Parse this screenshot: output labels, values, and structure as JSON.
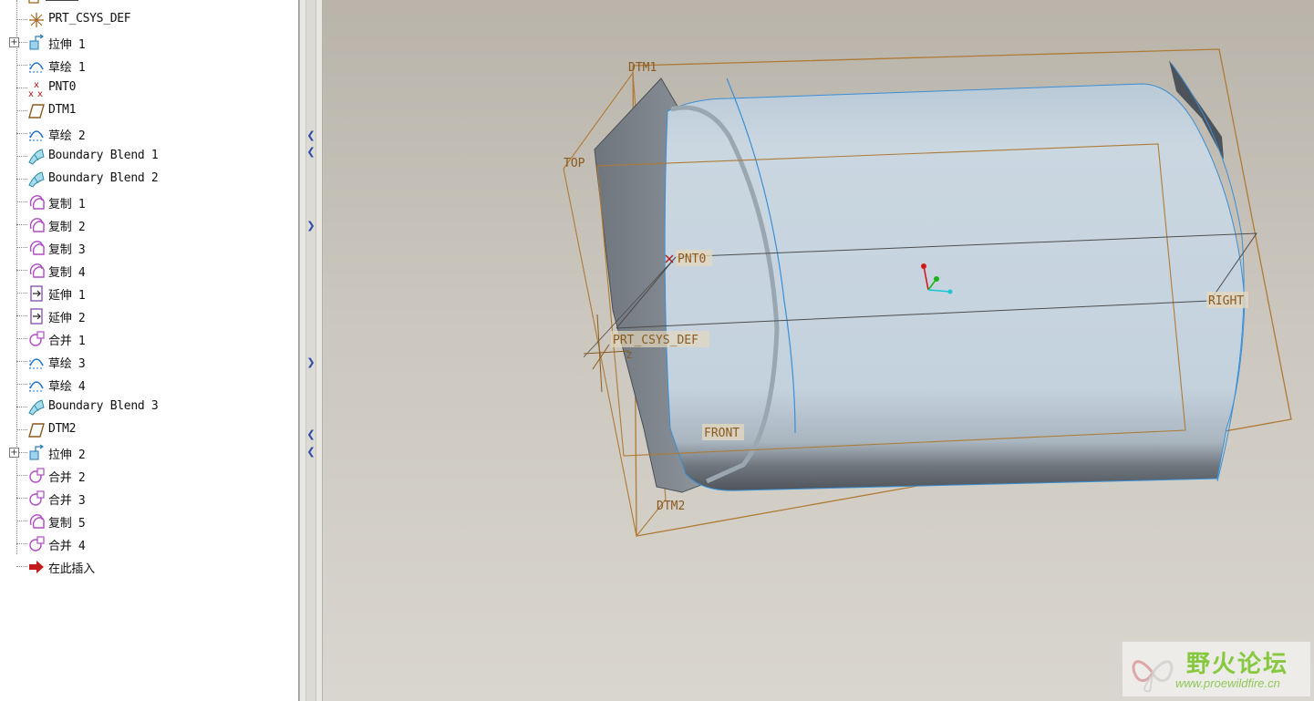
{
  "model_tree": {
    "items": [
      {
        "label": "PRT_CSYS_DEF",
        "icon": "csys-icon",
        "expandable": false
      },
      {
        "label": "拉伸 1",
        "icon": "extrude-icon",
        "expandable": true
      },
      {
        "label": "草绘 1",
        "icon": "sketch-icon",
        "expandable": false
      },
      {
        "label": "PNT0",
        "icon": "datum-point-icon",
        "expandable": false
      },
      {
        "label": "DTM1",
        "icon": "datum-plane-icon",
        "expandable": false
      },
      {
        "label": "草绘 2",
        "icon": "sketch-icon",
        "expandable": false
      },
      {
        "label": "Boundary Blend 1",
        "icon": "boundary-blend-icon",
        "expandable": false
      },
      {
        "label": "Boundary Blend 2",
        "icon": "boundary-blend-icon",
        "expandable": false
      },
      {
        "label": "复制 1",
        "icon": "copy-icon",
        "expandable": false
      },
      {
        "label": "复制 2",
        "icon": "copy-icon",
        "expandable": false
      },
      {
        "label": "复制 3",
        "icon": "copy-icon",
        "expandable": false
      },
      {
        "label": "复制 4",
        "icon": "copy-icon",
        "expandable": false
      },
      {
        "label": "延伸 1",
        "icon": "extend-icon",
        "expandable": false
      },
      {
        "label": "延伸 2",
        "icon": "extend-icon",
        "expandable": false
      },
      {
        "label": "合并 1",
        "icon": "merge-icon",
        "expandable": false
      },
      {
        "label": "草绘 3",
        "icon": "sketch-icon",
        "expandable": false
      },
      {
        "label": "草绘 4",
        "icon": "sketch-icon",
        "expandable": false
      },
      {
        "label": "Boundary Blend 3",
        "icon": "boundary-blend-icon",
        "expandable": false
      },
      {
        "label": "DTM2",
        "icon": "datum-plane-icon",
        "expandable": false
      },
      {
        "label": "拉伸 2",
        "icon": "extrude-icon",
        "expandable": true
      },
      {
        "label": "合并 2",
        "icon": "merge-icon",
        "expandable": false
      },
      {
        "label": "合并 3",
        "icon": "merge-icon",
        "expandable": false
      },
      {
        "label": "复制 5",
        "icon": "copy-icon",
        "expandable": false
      },
      {
        "label": "合并 4",
        "icon": "merge-icon",
        "expandable": false
      },
      {
        "label": "在此插入",
        "icon": "insert-here-arrow-icon",
        "expandable": false
      }
    ]
  },
  "viewport": {
    "datum_labels": {
      "dtm1": "DTM1",
      "top": "TOP",
      "pnt0": "PNT0",
      "prt_csys_def": "PRT_CSYS_DEF",
      "right": "RIGHT",
      "front": "FRONT",
      "dtm2": "DTM2",
      "csys_axis_z": "Z"
    },
    "colors": {
      "datum_plane": "#b07a35",
      "surface": "#c5d3de",
      "dark_face": "#5d646c",
      "edge": "#3a8fd6"
    }
  },
  "watermark": {
    "title": "野火论坛",
    "url": "www.proewildfire.cn"
  }
}
